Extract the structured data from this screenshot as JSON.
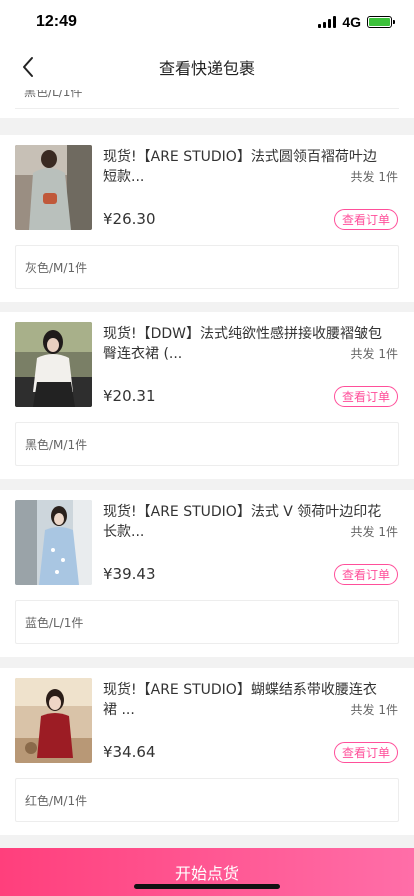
{
  "status_bar": {
    "time": "12:49",
    "network": "4G"
  },
  "nav": {
    "title": "查看快递包裹"
  },
  "partial_item": {
    "spec": "黑色/L/1件"
  },
  "items": [
    {
      "title": "现货!【ARE STUDIO】法式圆领百褶荷叶边短款...",
      "qty": "共发 1件",
      "price": "¥26.30",
      "order_label": "查看订单",
      "spec": "灰色/M/1件"
    },
    {
      "title": "现货!【DDW】法式纯欲性感拼接收腰褶皱包臀连衣裙 (...",
      "qty": "共发 1件",
      "price": "¥20.31",
      "order_label": "查看订单",
      "spec": "黑色/M/1件"
    },
    {
      "title": "现货!【ARE STUDIO】法式 V 领荷叶边印花长款...",
      "qty": "共发 1件",
      "price": "¥39.43",
      "order_label": "查看订单",
      "spec": "蓝色/L/1件"
    },
    {
      "title": "现货!【ARE STUDIO】蝴蝶结系带收腰连衣裙 ...",
      "qty": "共发 1件",
      "price": "¥34.64",
      "order_label": "查看订单",
      "spec": "红色/M/1件"
    }
  ],
  "bottom": {
    "button_label": "开始点货"
  },
  "colors": {
    "accent": "#ff4f9a",
    "gradient_start": "#ff3f7c",
    "gradient_end": "#ff6ea8"
  }
}
